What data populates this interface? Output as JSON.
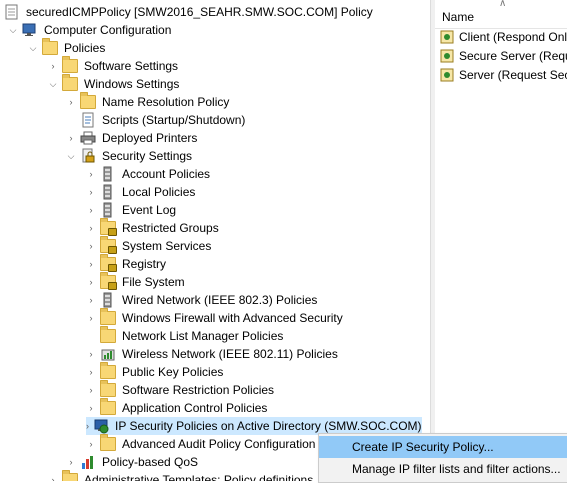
{
  "tree": {
    "root": "securedICMPPolicy [SMW2016_SEAHR.SMW.SOC.COM] Policy",
    "computer_config": "Computer Configuration",
    "policies": "Policies",
    "software_settings": "Software Settings",
    "windows_settings": "Windows Settings",
    "name_resolution": "Name Resolution Policy",
    "scripts": "Scripts (Startup/Shutdown)",
    "deployed_printers": "Deployed Printers",
    "security_settings": "Security Settings",
    "account_policies": "Account Policies",
    "local_policies": "Local Policies",
    "event_log": "Event Log",
    "restricted_groups": "Restricted Groups",
    "system_services": "System Services",
    "registry": "Registry",
    "file_system": "File System",
    "wired_network": "Wired Network (IEEE 802.3) Policies",
    "windows_firewall": "Windows Firewall with Advanced Security",
    "network_list": "Network List Manager Policies",
    "wireless_network": "Wireless Network (IEEE 802.11) Policies",
    "public_key": "Public Key Policies",
    "software_restriction": "Software Restriction Policies",
    "app_control": "Application Control Policies",
    "ip_security": "IP Security Policies on Active Directory (SMW.SOC.COM)",
    "advanced_audit": "Advanced Audit Policy Configuration",
    "policy_qos": "Policy-based QoS",
    "admin_templates": "Administrative Templates: Policy definitions"
  },
  "list": {
    "column_name": "Name",
    "items": [
      "Client (Respond Only)",
      "Secure Server (Requi...",
      "Server (Request Sec..."
    ]
  },
  "context_menu": {
    "items": [
      "Create IP Security Policy...",
      "Manage IP filter lists and filter actions..."
    ]
  },
  "colors": {
    "selection": "#cce8ff",
    "menu_highlight": "#91c9f7",
    "folder": "#f8d775"
  }
}
